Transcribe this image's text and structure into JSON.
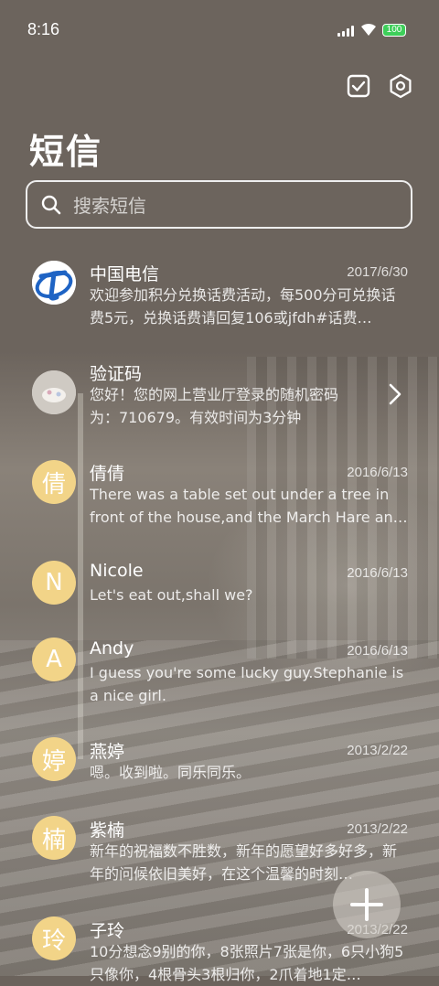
{
  "status": {
    "time": "8:16",
    "battery": "100"
  },
  "header": {
    "title": "短信"
  },
  "search": {
    "placeholder": "搜索短信"
  },
  "conversations": [
    {
      "name": "中国电信",
      "date": "2017/6/30",
      "preview": "欢迎参加积分兑换话费活动，每500分可兑换话费5元，兑换话费请回复106或jfdh#话费…",
      "avatar_text": "",
      "avatar_icon": "china-telecom-logo"
    },
    {
      "name": "验证码",
      "date": "",
      "preview": "您好！您的网上营业厅登录的随机密码为：710679。有效时间为3分钟",
      "avatar_text": "",
      "avatar_icon": "folder-photo"
    },
    {
      "name": "倩倩",
      "date": "2016/6/13",
      "preview": "There was a table set out under a tree in front of the house,and the March Hare an…",
      "avatar_text": "倩"
    },
    {
      "name": "Nicole",
      "date": "2016/6/13",
      "preview": "Let's eat out,shall we?",
      "avatar_text": "N"
    },
    {
      "name": "Andy",
      "date": "2016/6/13",
      "preview": "I guess you're some lucky guy.Stephanie is a nice girl.",
      "avatar_text": "A"
    },
    {
      "name": "燕婷",
      "date": "2013/2/22",
      "preview": "嗯。收到啦。同乐同乐。",
      "avatar_text": "婷"
    },
    {
      "name": "紫楠",
      "date": "2013/2/22",
      "preview": "新年的祝福数不胜数，新年的愿望好多好多，新年的问候依旧美好，在这个温馨的时刻…",
      "avatar_text": "楠"
    },
    {
      "name": "子玲",
      "date": "2013/2/22",
      "preview": "10分想念9别的你，8张照片7张是你，6只小狗5只像你，4根骨头3根归你，2爪着地1定…",
      "avatar_text": "玲"
    }
  ],
  "colors": {
    "avatar_bg": "#f2d488",
    "battery": "#3ecf5a",
    "telecom_blue": "#1e63c4"
  }
}
